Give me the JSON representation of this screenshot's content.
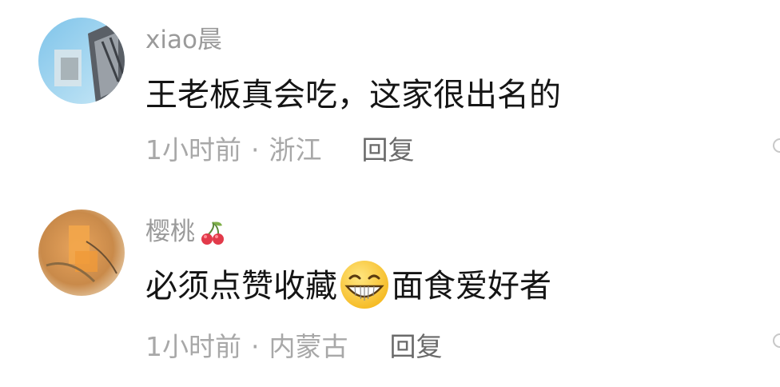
{
  "comments": [
    {
      "username": "xiao晨",
      "username_emoji": "",
      "text": "王老板真会吃，这家很出名的",
      "time": "1小时前",
      "separator": "·",
      "location": "浙江",
      "reply_label": "回复",
      "avatar_icon": "avatar-icon"
    },
    {
      "username": "樱桃",
      "username_emoji": "cherry-icon",
      "text_before_emoji": "必须点赞收藏",
      "inline_emoji": "grin-emoji-icon",
      "text_after_emoji": "面食爱好者",
      "time": "1小时前",
      "separator": "·",
      "location": "内蒙古",
      "reply_label": "回复",
      "avatar_icon": "avatar-icon"
    }
  ],
  "colors": {
    "username": "#9a9a9a",
    "content": "#151515",
    "meta": "#a8a8a8",
    "reply": "#6a6a6a",
    "background": "#ffffff"
  }
}
